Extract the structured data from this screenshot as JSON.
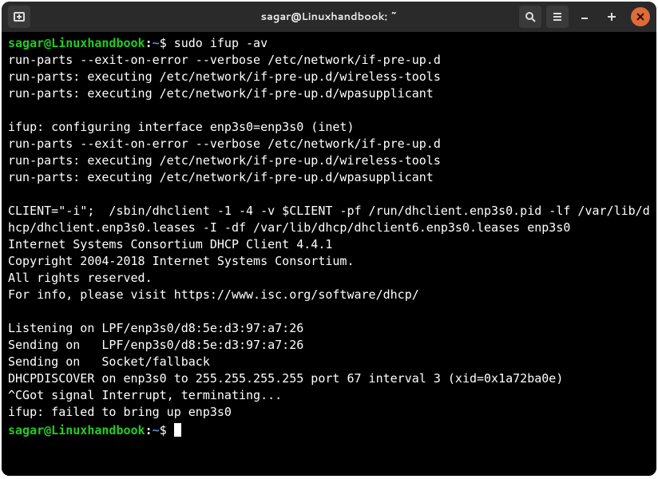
{
  "titlebar": {
    "title": "sagar@Linuxhandbook: ~"
  },
  "prompt": {
    "user_host": "sagar@Linuxhandbook",
    "colon": ":",
    "cwd": "~",
    "symbol": "$"
  },
  "commands": {
    "cmd1": "sudo ifup -av",
    "cmd2": ""
  },
  "output": {
    "l01": "run-parts --exit-on-error --verbose /etc/network/if-pre-up.d",
    "l02": "run-parts: executing /etc/network/if-pre-up.d/wireless-tools",
    "l03": "run-parts: executing /etc/network/if-pre-up.d/wpasupplicant",
    "l04": "",
    "l05": "ifup: configuring interface enp3s0=enp3s0 (inet)",
    "l06": "run-parts --exit-on-error --verbose /etc/network/if-pre-up.d",
    "l07": "run-parts: executing /etc/network/if-pre-up.d/wireless-tools",
    "l08": "run-parts: executing /etc/network/if-pre-up.d/wpasupplicant",
    "l09": "",
    "l10": "CLIENT=\"-i\";  /sbin/dhclient -1 -4 -v $CLIENT -pf /run/dhclient.enp3s0.pid -lf /var/lib/dhcp/dhclient.enp3s0.leases -I -df /var/lib/dhcp/dhclient6.enp3s0.leases enp3s0",
    "l11": "Internet Systems Consortium DHCP Client 4.4.1",
    "l12": "Copyright 2004-2018 Internet Systems Consortium.",
    "l13": "All rights reserved.",
    "l14": "For info, please visit https://www.isc.org/software/dhcp/",
    "l15": "",
    "l16": "Listening on LPF/enp3s0/d8:5e:d3:97:a7:26",
    "l17": "Sending on   LPF/enp3s0/d8:5e:d3:97:a7:26",
    "l18": "Sending on   Socket/fallback",
    "l19": "DHCPDISCOVER on enp3s0 to 255.255.255.255 port 67 interval 3 (xid=0x1a72ba0e)",
    "l20": "^CGot signal Interrupt, terminating...",
    "l21": "ifup: failed to bring up enp3s0"
  }
}
